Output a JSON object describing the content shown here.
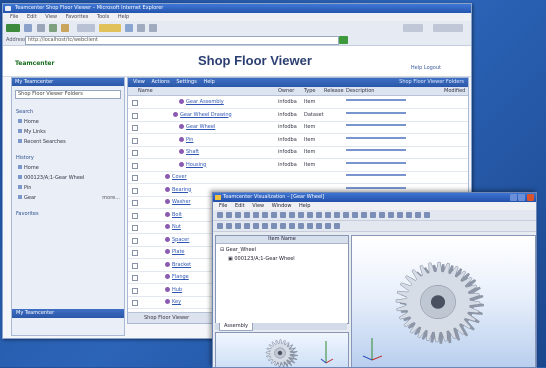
{
  "browser": {
    "title": "Teamcenter Shop Floor Viewer – Microsoft Internet Explorer",
    "menu": [
      "File",
      "Edit",
      "View",
      "Favorites",
      "Tools",
      "Help"
    ],
    "address_label": "Address",
    "address_value": "http://localhost/tc/webclient"
  },
  "app": {
    "logo": "Teamcenter",
    "title": "Shop Floor Viewer",
    "header_links": "Help   Logout"
  },
  "left_panel": {
    "title": "My Teamcenter",
    "select_value": "Shop Floor Viewer Folders",
    "section1_title": "Search",
    "section1_items": [
      "Home",
      "My Links",
      "Recent Searches"
    ],
    "section2_title": "History",
    "section2_items": [
      "Home",
      "000123/A;1-Gear Wheel",
      "Pin",
      "Gear"
    ],
    "more_label": "more...",
    "favorites_label": "Favorites",
    "bottom_title": "My Teamcenter"
  },
  "main": {
    "menu": [
      "View",
      "Actions",
      "Settings",
      "Help"
    ],
    "menu_right": "Shop Floor Viewer Folders",
    "columns": [
      "Name",
      "Owner",
      "Type",
      "Release",
      "Description",
      "Modified"
    ],
    "rows": [
      {
        "name": "Gear Assembly",
        "owner": "infodba",
        "type": "Item"
      },
      {
        "name": "Gear Wheel Drawing",
        "owner": "infodba",
        "type": "Dataset"
      },
      {
        "name": "Gear Wheel",
        "owner": "infodba",
        "type": "Item"
      },
      {
        "name": "Pin",
        "owner": "infodba",
        "type": "Item"
      },
      {
        "name": "Shaft",
        "owner": "infodba",
        "type": "Item"
      },
      {
        "name": "Housing",
        "owner": "infodba",
        "type": "Item"
      },
      {
        "name": "Cover",
        "owner": "",
        "type": ""
      },
      {
        "name": "Bearing",
        "owner": "",
        "type": ""
      },
      {
        "name": "Washer",
        "owner": "",
        "type": ""
      },
      {
        "name": "Bolt",
        "owner": "",
        "type": ""
      },
      {
        "name": "Nut",
        "owner": "",
        "type": ""
      },
      {
        "name": "Spacer",
        "owner": "",
        "type": ""
      },
      {
        "name": "Plate",
        "owner": "",
        "type": ""
      },
      {
        "name": "Bracket",
        "owner": "",
        "type": ""
      },
      {
        "name": "Flange",
        "owner": "",
        "type": ""
      },
      {
        "name": "Hub",
        "owner": "",
        "type": ""
      },
      {
        "name": "Key",
        "owner": "",
        "type": ""
      }
    ],
    "status": "Shop Floor Viewer"
  },
  "cad": {
    "title": "Teamcenter Visualization – [Gear Wheel]",
    "menu": [
      "File",
      "Edit",
      "View",
      "Window",
      "Help"
    ],
    "tree_header": "Item Name",
    "tree_nodes": [
      "Gear_Wheel",
      "000123/A;1-Gear Wheel"
    ],
    "tab_label": "Assembly"
  },
  "colors": {
    "background": "#2c64b8",
    "title_bar": "#2455b0",
    "accent_green": "#3c9a3c",
    "link": "#2f56b3"
  }
}
